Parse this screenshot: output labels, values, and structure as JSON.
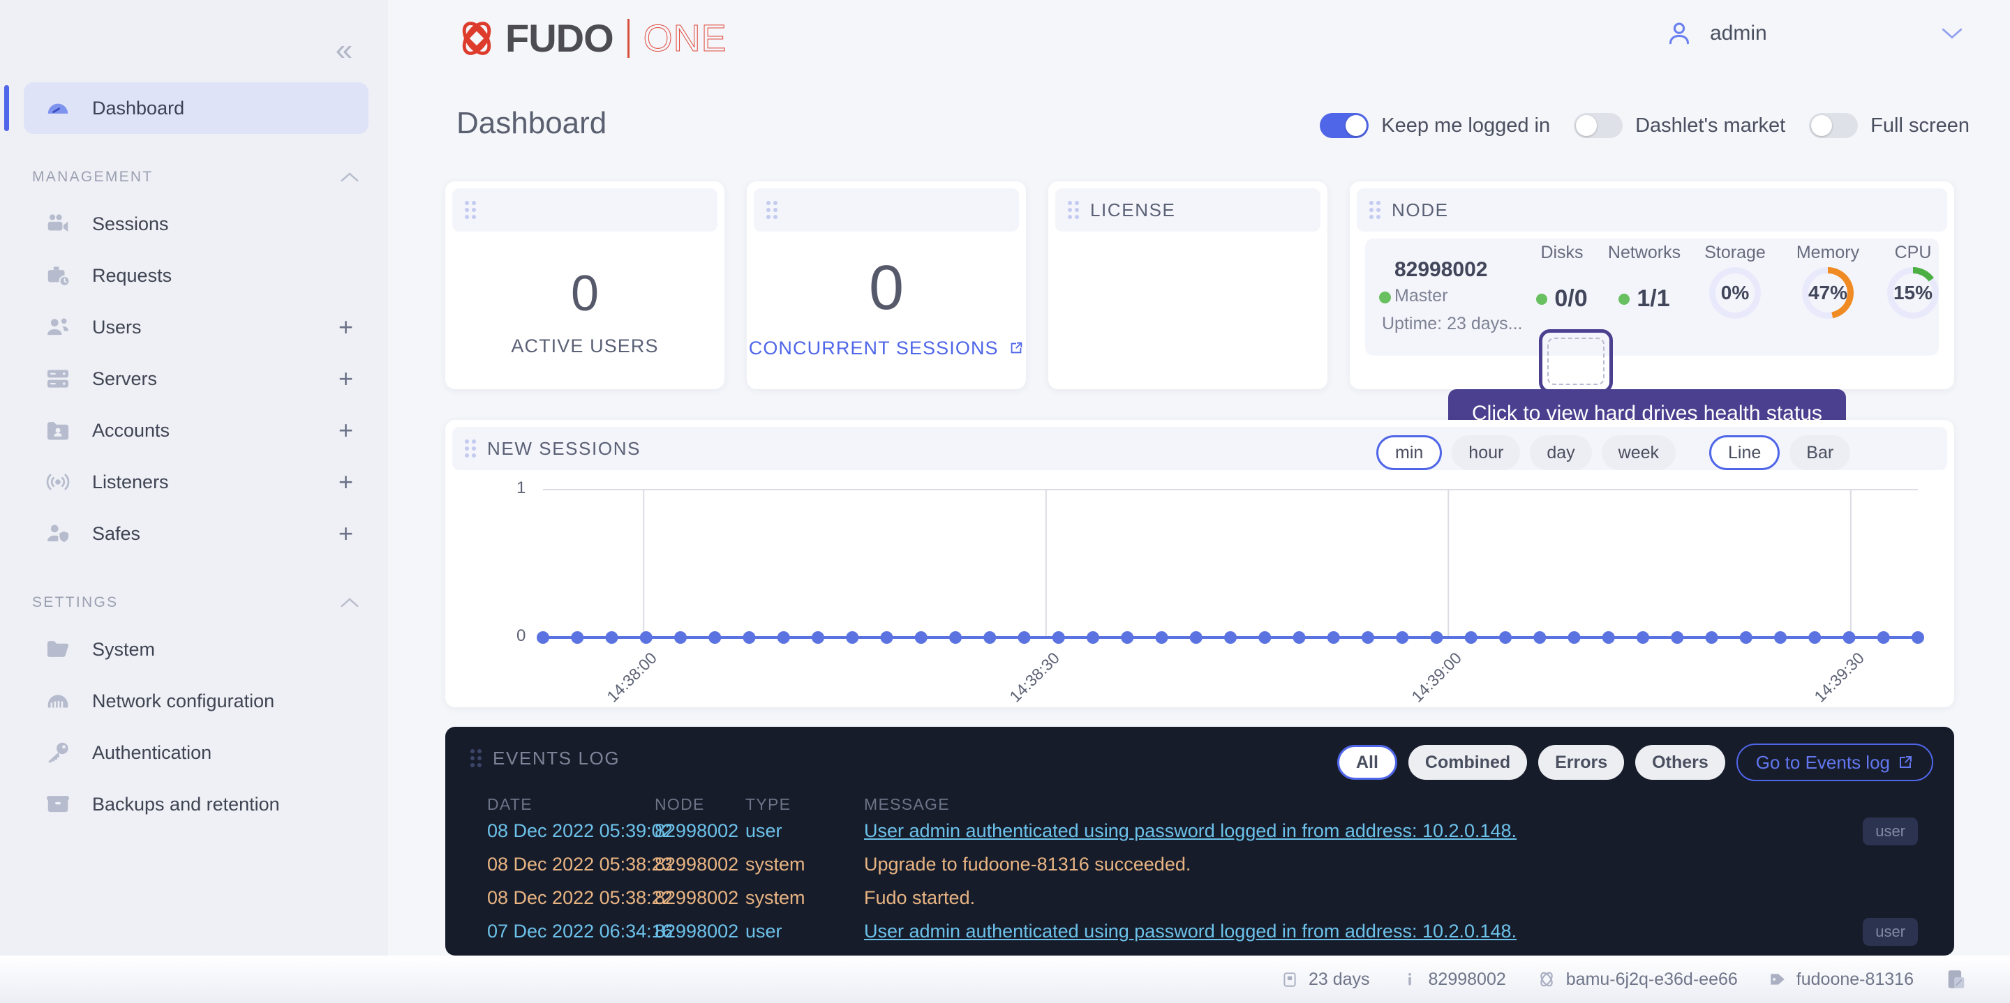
{
  "app": {
    "logo_main": "FUDO",
    "logo_sub": "ONE"
  },
  "header": {
    "user_name": "admin",
    "user_icon": "user-avatar-icon",
    "caret_icon": "chevron-down-icon",
    "collapse_icon": "chevron-double-left-icon"
  },
  "page": {
    "title": "Dashboard"
  },
  "toggles": [
    {
      "label": "Keep me logged in",
      "on": true
    },
    {
      "label": "Dashlet's market",
      "on": false
    },
    {
      "label": "Full screen",
      "on": false
    }
  ],
  "sidebar": {
    "items": [
      {
        "label": "Dashboard",
        "icon": "gauge-icon",
        "active": true,
        "plus": false
      }
    ],
    "sections": [
      {
        "label": "MANAGEMENT",
        "items": [
          {
            "label": "Sessions",
            "icon": "video-camera-icon",
            "plus": false
          },
          {
            "label": "Requests",
            "icon": "briefcase-clock-icon",
            "plus": false
          },
          {
            "label": "Users",
            "icon": "users-icon",
            "plus": true
          },
          {
            "label": "Servers",
            "icon": "server-icon",
            "plus": true
          },
          {
            "label": "Accounts",
            "icon": "folder-user-icon",
            "plus": true
          },
          {
            "label": "Listeners",
            "icon": "broadcast-icon",
            "plus": true
          },
          {
            "label": "Safes",
            "icon": "user-shield-icon",
            "plus": true
          }
        ]
      },
      {
        "label": "SETTINGS",
        "items": [
          {
            "label": "System",
            "icon": "folder-icon",
            "plus": false
          },
          {
            "label": "Network configuration",
            "icon": "network-icon",
            "plus": false
          },
          {
            "label": "Authentication",
            "icon": "key-icon",
            "plus": false
          },
          {
            "label": "Backups and retention",
            "icon": "archive-icon",
            "plus": false
          }
        ]
      }
    ]
  },
  "dashlets": {
    "active_users": {
      "title": "",
      "value": "0",
      "label": "ACTIVE USERS"
    },
    "concurrent_sessions": {
      "title": "",
      "value": "0",
      "label": "CONCURRENT SESSIONS",
      "external_icon": "external-link-icon"
    },
    "license": {
      "title": "LICENSE"
    },
    "node": {
      "title": "NODE",
      "name": "82998002",
      "role": "Master",
      "uptime": "Uptime: 23 days...",
      "status_color": "#68c061",
      "metrics": [
        {
          "label": "Disks",
          "value": "0/0",
          "type": "counter",
          "dot": true
        },
        {
          "label": "Networks",
          "value": "1/1",
          "type": "counter",
          "dot": true
        },
        {
          "label": "Storage",
          "value": "0%",
          "type": "ring",
          "percent": 0,
          "color": "#e8eafc"
        },
        {
          "label": "Memory",
          "value": "47%",
          "type": "ring",
          "percent": 47,
          "color": "#f08a22"
        },
        {
          "label": "CPU",
          "value": "15%",
          "type": "ring",
          "percent": 15,
          "color": "#4caf43"
        }
      ],
      "tooltip": "Click to view hard drives health status"
    }
  },
  "chart_panel": {
    "title": "NEW SESSIONS",
    "range_buttons": [
      {
        "label": "min",
        "selected": true
      },
      {
        "label": "hour",
        "selected": false
      },
      {
        "label": "day",
        "selected": false
      },
      {
        "label": "week",
        "selected": false
      }
    ],
    "type_buttons": [
      {
        "label": "Line",
        "selected": true
      },
      {
        "label": "Bar",
        "selected": false
      }
    ]
  },
  "chart_data": {
    "type": "line",
    "title": "NEW SESSIONS",
    "xlabel": "",
    "ylabel": "",
    "ylim": [
      0,
      1
    ],
    "ytick_labels": [
      "0",
      "1"
    ],
    "grid": true,
    "legend": "none",
    "x_tick_labels": [
      "14:38:00",
      "14:38:30",
      "14:39:00",
      "14:39:30"
    ],
    "x_tick_positions": [
      0.0732,
      0.3659,
      0.6585,
      0.9512
    ],
    "series": [
      {
        "name": "new sessions",
        "color": "#5a73e0",
        "n_points": 41,
        "values": [
          0,
          0,
          0,
          0,
          0,
          0,
          0,
          0,
          0,
          0,
          0,
          0,
          0,
          0,
          0,
          0,
          0,
          0,
          0,
          0,
          0,
          0,
          0,
          0,
          0,
          0,
          0,
          0,
          0,
          0,
          0,
          0,
          0,
          0,
          0,
          0,
          0,
          0,
          0,
          0,
          0
        ]
      }
    ]
  },
  "events": {
    "title": "EVENTS LOG",
    "filters": [
      {
        "label": "All",
        "selected": true
      },
      {
        "label": "Combined",
        "selected": false
      },
      {
        "label": "Errors",
        "selected": false
      },
      {
        "label": "Others",
        "selected": false
      }
    ],
    "goto_label": "Go to Events log",
    "goto_icon": "external-link-icon",
    "columns": [
      "DATE",
      "NODE",
      "TYPE",
      "MESSAGE"
    ],
    "rows": [
      {
        "date": "08 Dec 2022 05:39:02",
        "node": "82998002",
        "type": "user",
        "message": "User admin authenticated using password logged in from address: 10.2.0.148.",
        "badge": "user",
        "color": "#6cc2ea"
      },
      {
        "date": "08 Dec 2022 05:38:23",
        "node": "82998002",
        "type": "system",
        "message": "Upgrade to fudoone-81316 succeeded.",
        "badge": "",
        "color": "#e8b482"
      },
      {
        "date": "08 Dec 2022 05:38:22",
        "node": "82998002",
        "type": "system",
        "message": "Fudo started.",
        "badge": "",
        "color": "#e8b482"
      },
      {
        "date": "07 Dec 2022 06:34:16",
        "node": "82998002",
        "type": "user",
        "message": "User admin authenticated using password logged in from address: 10.2.0.148.",
        "badge": "user",
        "color": "#6cc2ea"
      }
    ]
  },
  "statusbar": {
    "items": [
      {
        "icon": "calendar-icon",
        "text": "23 days"
      },
      {
        "icon": "info-icon",
        "text": "82998002"
      },
      {
        "icon": "fudo-mark-icon",
        "text": "bamu-6j2q-e36d-ee66"
      },
      {
        "icon": "tag-icon",
        "text": "fudoone-81316"
      }
    ],
    "trailing_icon": "report-icon"
  },
  "colors": {
    "accent": "#4f66e8",
    "brand_red": "#e0483a",
    "ok_green": "#68c061",
    "warn_orange": "#f08a22",
    "tooltip_purple": "#4b3f8f",
    "panel_dark": "#171c2b"
  }
}
